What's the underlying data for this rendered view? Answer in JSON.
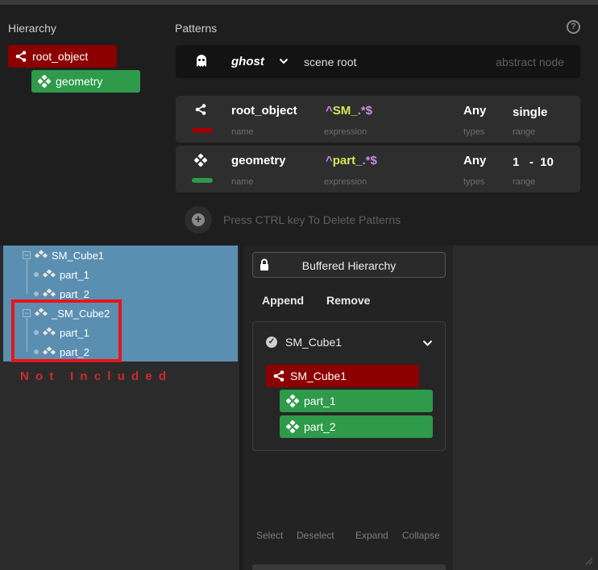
{
  "hierarchy": {
    "label": "Hierarchy",
    "nodes": [
      {
        "label": "root_object",
        "icon": "share-icon",
        "color": "#8c0000"
      },
      {
        "label": "geometry",
        "icon": "diamond-cluster-icon",
        "color": "#2e9a4a"
      }
    ]
  },
  "patterns": {
    "label": "Patterns",
    "help_icon": "help-icon",
    "ghost": {
      "name": "ghost",
      "scope": "scene root",
      "placeholder": "abstract node"
    },
    "rows": [
      {
        "name": "root_object",
        "name_label": "name",
        "expr_caret": "^",
        "expr_text": "SM_",
        "expr_wild": ".*$",
        "expr_label": "expression",
        "types": "Any",
        "types_label": "types",
        "range": "single",
        "range_label": "range",
        "swatch": "#8c0000"
      },
      {
        "name": "geometry",
        "name_label": "name",
        "expr_caret": "^",
        "expr_text": "part_",
        "expr_wild": ".*$",
        "expr_label": "expression",
        "types": "Any",
        "types_label": "types",
        "range": "1   -  10",
        "range_label": "range",
        "swatch": "#2e9a4a"
      }
    ],
    "hint": "Press CTRL key To Delete Patterns"
  },
  "outliner": {
    "items": [
      {
        "label": "SM_Cube1"
      },
      {
        "label": "part_1"
      },
      {
        "label": "part_2"
      },
      {
        "label": "_SM_Cube2"
      },
      {
        "label": "part_1"
      },
      {
        "label": "part_2"
      }
    ],
    "annotation": "Not Included"
  },
  "buffered": {
    "title": "Buffered Hierarchy",
    "append": "Append",
    "remove": "Remove",
    "header": "SM_Cube1",
    "nodes": [
      {
        "label": "SM_Cube1"
      },
      {
        "label": "part_1"
      },
      {
        "label": "part_2"
      }
    ],
    "footer": [
      "Select",
      "Deselect",
      "Expand",
      "Collapse"
    ]
  }
}
